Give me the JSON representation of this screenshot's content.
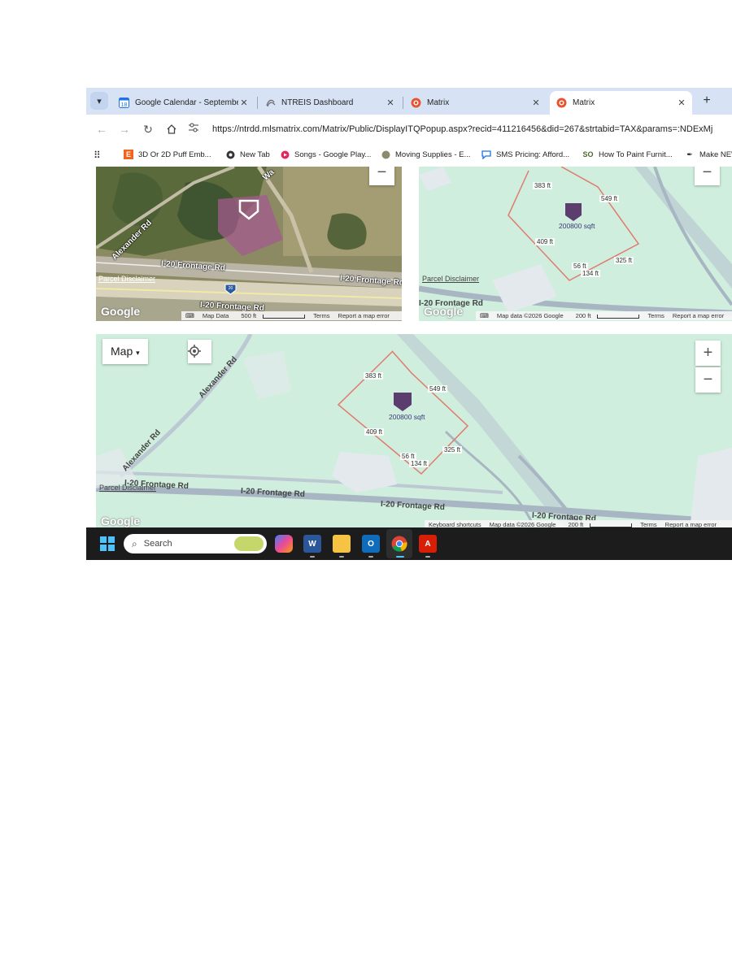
{
  "browser": {
    "tabs": [
      {
        "title": "Google Calendar - Septembe",
        "favicon": "calendar-icon",
        "badge": "18"
      },
      {
        "title": "NTREIS Dashboard",
        "favicon": "ntreis-icon"
      },
      {
        "title": "Matrix",
        "favicon": "matrix-icon"
      },
      {
        "title": "Matrix",
        "favicon": "matrix-icon"
      }
    ],
    "url": "https://ntrdd.mlsmatrix.com/Matrix/Public/DisplayITQPopup.aspx?recid=411216456&did=267&strtabid=TAX&params=:NDExMj",
    "bookmarks": [
      {
        "label": "3D Or 2D  Puff Emb...",
        "icon": "etsy-icon",
        "glyph": "E"
      },
      {
        "label": "New Tab",
        "icon": "chrome-icon"
      },
      {
        "label": "Songs - Google Play...",
        "icon": "play-music-icon"
      },
      {
        "label": "Moving Supplies - E...",
        "icon": "globe-icon"
      },
      {
        "label": "SMS Pricing: Afford...",
        "icon": "chat-icon"
      },
      {
        "label": "How To Paint Furnit...",
        "icon": "so-icon",
        "glyph": "SO"
      },
      {
        "label": "Make NEW",
        "icon": "pen-icon"
      }
    ]
  },
  "map_satellite": {
    "roads": [
      "Alexander Rd",
      "I-20 Frontage Rd",
      "I-20 Frontage Rd",
      "I-20 Frontage Rd",
      "Wa"
    ],
    "highway_shield": "20",
    "disclaimer": "Parcel Disclaimer",
    "logo": "Google",
    "footer": {
      "map_data": "Map Data",
      "scale": "500 ft",
      "terms": "Terms",
      "report": "Report a map error"
    }
  },
  "map_parcel_small": {
    "edge_labels": [
      "383 ft",
      "549 ft",
      "409 ft",
      "56 ft",
      "134 ft",
      "325 ft"
    ],
    "area": "200800 sqft",
    "roads": [
      "I-20 Frontage Rd"
    ],
    "disclaimer": "Parcel Disclaimer",
    "logo": "Google",
    "footer": {
      "map_data": "Map data ©2026 Google",
      "scale": "200 ft",
      "terms": "Terms",
      "report": "Report a map error"
    }
  },
  "map_parcel_large": {
    "map_type": "Map",
    "edge_labels": [
      "383 ft",
      "549 ft",
      "409 ft",
      "56 ft",
      "134 ft",
      "325 ft"
    ],
    "area": "200800 sqft",
    "roads": [
      "Alexander Rd",
      "Alexander Rd",
      "I-20 Frontage Rd",
      "I-20 Frontage Rd",
      "I-20 Frontage Rd",
      "I-20 Frontage Rd"
    ],
    "disclaimer": "Parcel Disclaimer",
    "logo": "Google",
    "footer": {
      "shortcuts": "Keyboard shortcuts",
      "map_data": "Map data ©2026 Google",
      "scale": "200 ft",
      "terms": "Terms",
      "report": "Report a map error"
    }
  },
  "taskbar": {
    "search_placeholder": "Search",
    "apps": [
      "copilot-icon",
      "word-icon",
      "file-explorer-icon",
      "outlook-icon",
      "chrome-icon",
      "acrobat-icon"
    ]
  },
  "colors": {
    "tabstrip": "#d7e3f5",
    "map_green": "#cfeedd",
    "parcel_line": "#e07a6f",
    "marker": "#5b3d6e",
    "taskbar": "#1c1c1c"
  }
}
